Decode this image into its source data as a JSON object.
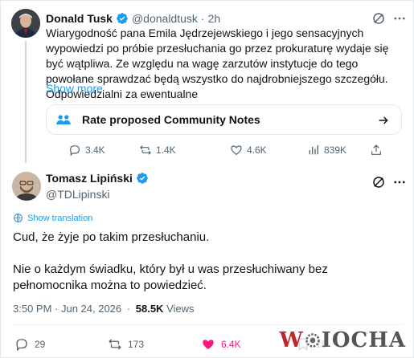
{
  "tweet1": {
    "author_name": "Donald Tusk",
    "handle": "@donaldtusk",
    "separator": "·",
    "time": "2h",
    "text": "Wiarygodność pana Emila Jędrzejewskiego i jego sensacyjnych wypowiedzi po próbie przesłuchania go przez prokuraturę wydaje się być wątpliwa. Ze względu na wagę zarzutów instytucje do tego powołane sprawdzać będą wszystko do najdrobniejszego szczegółu. Odpowiedzialni za ewentualne",
    "show_more": "Show more",
    "community_notes_label": "Rate proposed Community Notes",
    "stats": {
      "replies": "3.4K",
      "reposts": "1.4K",
      "likes": "4.6K",
      "views": "839K"
    }
  },
  "tweet2": {
    "author_name": "Tomasz Lipiński",
    "handle": "@TDLipinski",
    "show_translation": "Show translation",
    "paragraphs": [
      "Cud, że żyje po takim przesłuchaniu.",
      "Nie o każdym świadku, który był u was przesłuchiwany bez pełnomocnika można to powiedzieć."
    ],
    "time": "3:50 PM · Jun 24, 2026",
    "meta_separator": "·",
    "views_count": "58.5K",
    "views_label": "Views",
    "stats": {
      "replies": "29",
      "reposts": "173",
      "likes": "6.4K",
      "bookmarks": "15"
    }
  },
  "watermark": {
    "part1": "W",
    "part2": "IOCHA"
  },
  "colors": {
    "accent": "#1d9bf0",
    "like": "#f91880",
    "muted": "#536471",
    "text": "#0f1419"
  },
  "icons": [
    "verified-badge-icon",
    "grok-icon",
    "more-options-icon",
    "people-icon",
    "arrow-right-icon",
    "reply-icon",
    "repost-icon",
    "like-icon",
    "views-icon",
    "share-icon",
    "translate-icon",
    "bookmark-icon"
  ]
}
